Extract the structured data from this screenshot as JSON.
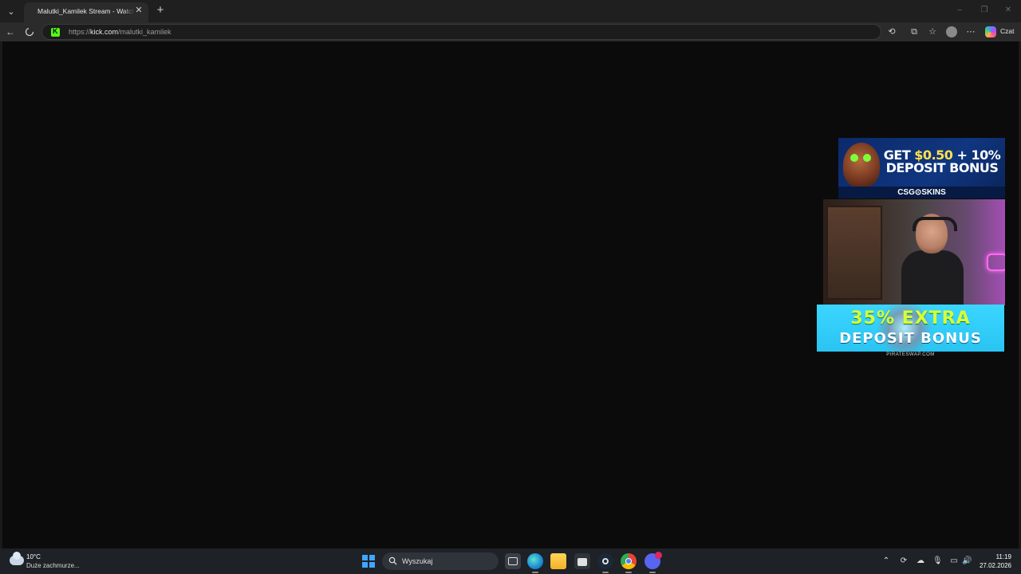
{
  "browser": {
    "tab": {
      "title": "Malutki_Kamilek Stream - Watch Live on Kick"
    },
    "address": {
      "scheme": "https://",
      "host": "kick.com",
      "path": "/malutki_kamilek"
    },
    "toolbar": {
      "chat_label": "Czat"
    },
    "icons": {
      "tab_menu": "chevron-down-icon",
      "tab_close": "close-icon",
      "new_tab": "plus-icon",
      "back": "arrow-left-icon",
      "loading": "loading-spinner-icon",
      "site_favicon": "kick-logo-icon",
      "extensions": "puzzle-icon",
      "tab_actions": "tab-actions-icon",
      "favorites": "star-icon",
      "profile": "avatar-icon",
      "more": "ellipsis-icon",
      "copilot": "copilot-icon"
    }
  },
  "stream_overlay": {
    "ad_top": {
      "line1_prefix": "GET ",
      "line1_highlight": "$0.50",
      "line1_suffix": " + 10%",
      "line2": "DEPOSIT BONUS",
      "brand": "CSG⊙SKINS"
    },
    "ad_bottom": {
      "line1": "35% EXTRA",
      "line2": "DEPOSIT BONUS",
      "domain": "PIRATESWAP.COM"
    },
    "colors": {
      "kick_green": "#53fc18",
      "csg_blue": "#103680",
      "pirate_cyan": "#3ad6ff",
      "pirate_lime": "#d8ff3a"
    }
  },
  "taskbar": {
    "weather": {
      "temp": "10°C",
      "desc": "Duże zachmurze..."
    },
    "search": {
      "placeholder": "Wyszukaj"
    },
    "clock": {
      "time": "11:19",
      "date": "27.02.2026"
    },
    "apps": [
      "start-icon",
      "task-view-icon",
      "edge-icon",
      "file-explorer-icon",
      "store-icon",
      "steam-icon",
      "chrome-icon",
      "discord-icon"
    ],
    "tray": [
      "chevron-up-icon",
      "tray-app-icon",
      "onedrive-icon",
      "microphone-icon",
      "network-icon",
      "volume-icon"
    ]
  }
}
